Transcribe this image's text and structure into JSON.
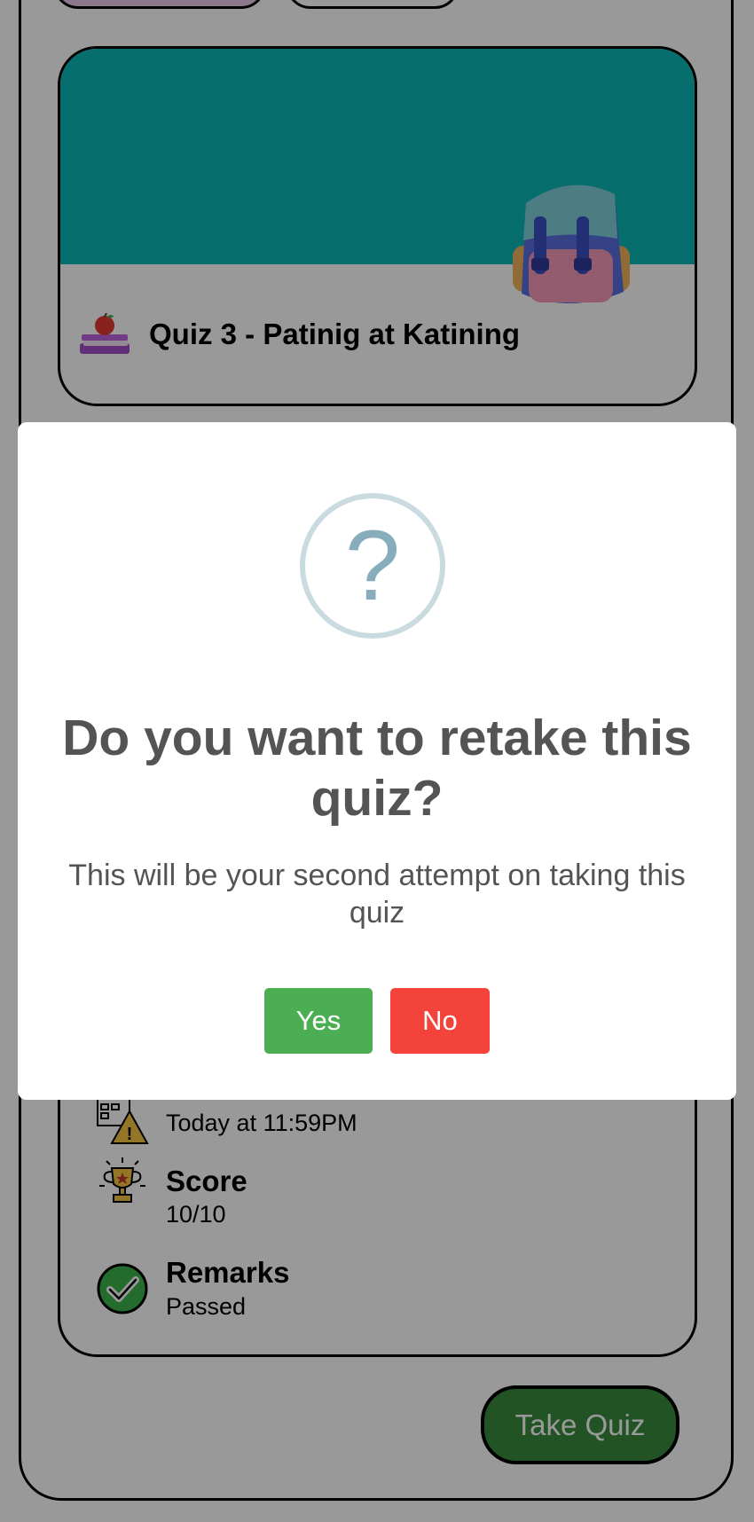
{
  "quiz_card": {
    "title": "Quiz 3 - Patinig at Katining",
    "banner_color": "#0ab7b5"
  },
  "details": {
    "due_value": "Today at 11:59PM",
    "score_label": "Score",
    "score_value": "10/10",
    "remarks_label": "Remarks",
    "remarks_value": "Passed"
  },
  "take_quiz_label": "Take Quiz",
  "dialog": {
    "icon": "?",
    "title": "Do you want to retake this quiz?",
    "text": "This will be your second attempt on taking this quiz",
    "yes_label": "Yes",
    "no_label": "No",
    "yes_color": "#4cae52",
    "no_color": "#f4433a"
  }
}
